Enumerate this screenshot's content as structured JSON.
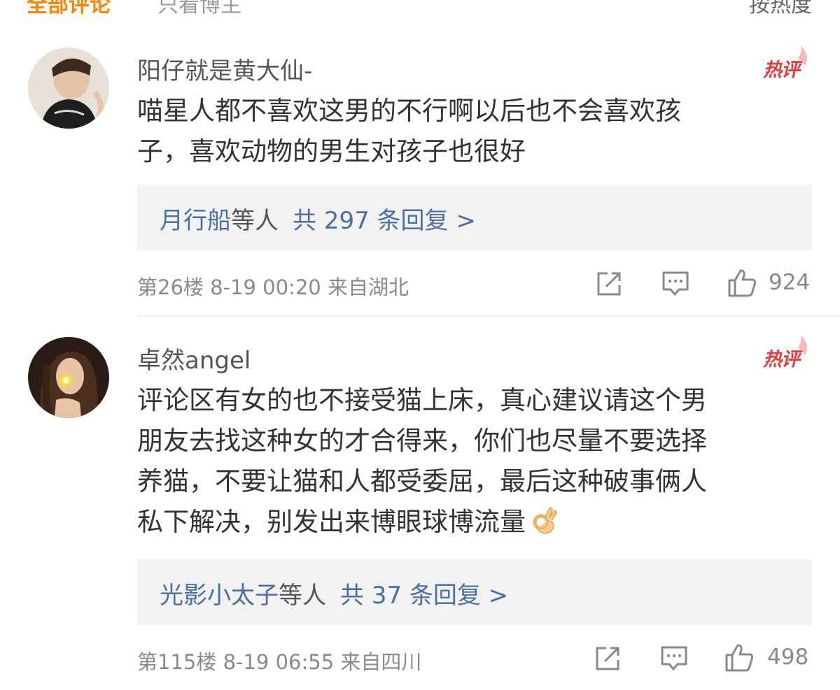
{
  "top_bar": {
    "tab_all": "全部评论",
    "tab_fans": "只看博主",
    "sort": "按热度"
  },
  "comments": [
    {
      "username": "阳仔就是黄大仙-",
      "badge": "热评",
      "text_lines": [
        "喵星人都不喜欢这男的不行啊以后也不会喜欢孩",
        "子，喜欢动物的男生对孩子也很好"
      ],
      "replies": {
        "names": "月行船",
        "mid": "等人",
        "count": "共 297 条回复 >"
      },
      "meta": "第26楼  8-19 00:20  来自湖北",
      "like_count": "924"
    },
    {
      "username": "卓然angel",
      "badge": "热评",
      "text_lines": [
        "评论区有女的也不接受猫上床，真心建议请这个男",
        "朋友去找这种女的才合得来，你们也尽量不要选择",
        "养猫，不要让猫和人都受委屈，最后这种破事俩人",
        "私下解决，别发出来博眼球博流量"
      ],
      "emoji": "ok-hand-emoji",
      "replies": {
        "names": "光影小太子",
        "mid": "等人",
        "count": "共 37 条回复 >"
      },
      "meta": "第115楼  8-19 06:55  来自四川",
      "like_count": "498"
    }
  ],
  "colors": {
    "accent_orange": "#ff8200",
    "link_blue": "#4a6ea8",
    "hot_red": "#e83a3a",
    "reply_bg": "#f2f2f2",
    "meta_gray": "#8a8a8a"
  },
  "icons": [
    "share-icon",
    "comment-icon",
    "like-icon"
  ]
}
